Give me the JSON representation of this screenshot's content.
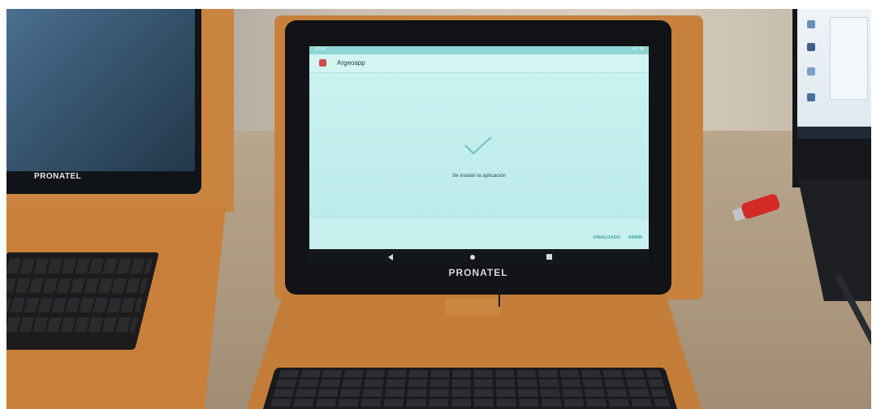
{
  "left_tablet": {
    "brand": "PRONATEL"
  },
  "center_tablet": {
    "brand": "PRONATEL",
    "status_bar": {
      "time": "10:47",
      "battery": "47 %"
    },
    "app": {
      "title": "Argeoapp"
    },
    "message": "Se instaló la aplicación",
    "actions": {
      "done": "FINALIZADO",
      "open": "ABRIR"
    }
  },
  "colors": {
    "screen": "#c8f0ee",
    "case": "#c7813c",
    "accent": "#3aa6a6"
  },
  "icons": [
    "check-icon",
    "back-icon",
    "home-icon",
    "recents-icon",
    "app-icon"
  ]
}
